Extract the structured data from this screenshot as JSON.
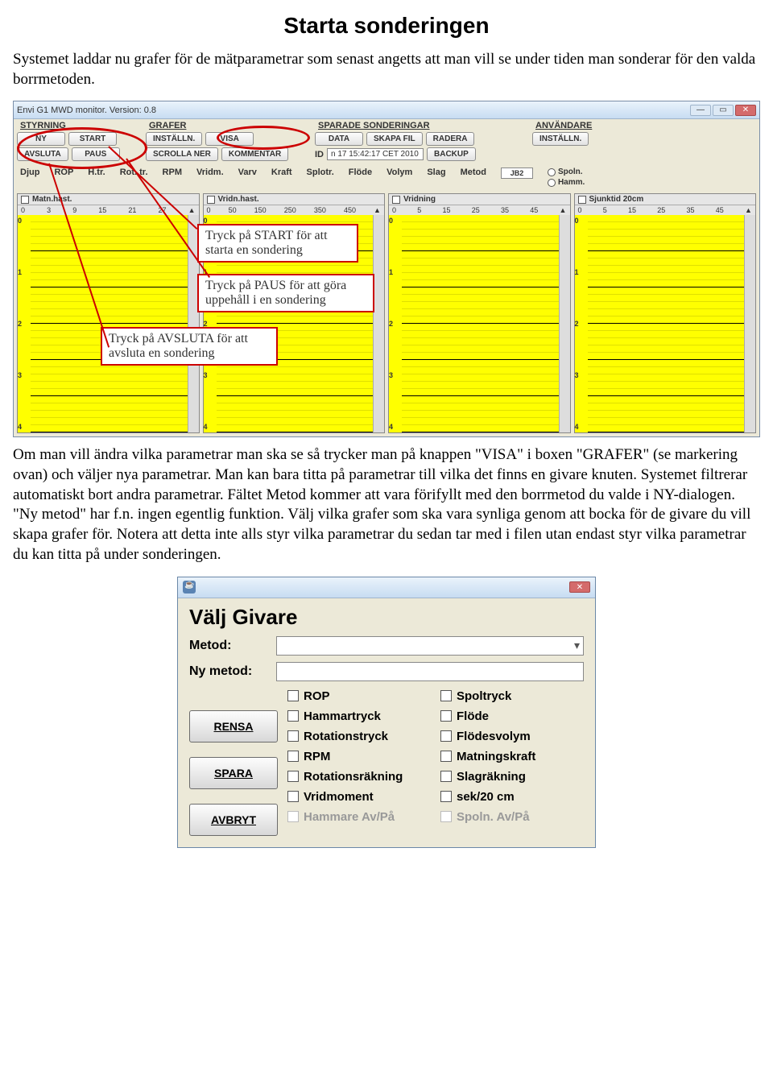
{
  "doc": {
    "title": "Starta sonderingen",
    "intro": "Systemet laddar nu grafer för de mätparametrar som senast angetts att man vill se under tiden man sonderar för den valda borrmetoden.",
    "para2": "Om man vill ändra vilka parametrar man ska se så trycker man på knappen \"VISA\" i boxen \"GRAFER\" (se markering ovan) och väljer nya parametrar. Man kan bara titta på parametrar till vilka det finns en givare knuten. Systemet filtrerar automatiskt bort andra parametrar. Fältet Metod kommer att vara förifyllt med den borrmetod du valde i NY-dialogen. \"Ny metod\" har f.n. ingen egentlig funktion. Välj vilka grafer som ska vara synliga genom att bocka för de givare du vill skapa grafer för. Notera att detta inte alls styr vilka parametrar du sedan tar med i filen utan endast styr vilka parametrar du kan titta på under sonderingen."
  },
  "callouts": {
    "start": "Tryck på START för att starta en sondering",
    "paus": "Tryck på PAUS för att göra uppehåll i en sondering",
    "avsluta": "Tryck på AVSLUTA för att avsluta en sondering"
  },
  "app": {
    "title": "Envi G1 MWD monitor. Version: 0.8",
    "groups": {
      "styrning": {
        "label": "STYRNING",
        "ny": "NY",
        "start": "START",
        "avsluta": "AVSLUTA",
        "paus": "PAUS"
      },
      "grafer": {
        "label": "GRAFER",
        "installn": "INSTÄLLN.",
        "visa": "VISA",
        "scrolla": "SCROLLA NER",
        "kommentar": "KOMMENTAR"
      },
      "sparade": {
        "label": "SPARADE SONDERINGAR",
        "data": "DATA",
        "skapa": "SKAPA FIL",
        "radera": "RADERA",
        "id_label": "ID",
        "id_value": "n 17 15:42:17 CET 2010",
        "backup": "BACKUP"
      },
      "anvandare": {
        "label": "ANVÄNDARE",
        "installn": "INSTÄLLN."
      }
    },
    "params": {
      "djup": "Djup",
      "rop": "ROP",
      "htr": "H.tr.",
      "rottr": "Rot. tr.",
      "rpm": "RPM",
      "vridm": "Vridm.",
      "varv": "Varv",
      "kraft": "Kraft",
      "splotr": "Splotr.",
      "flode": "Flöde",
      "volym": "Volym",
      "slag": "Slag",
      "metod": "Metod",
      "metod_value": "JB2",
      "spoln": "Spoln.",
      "hamm": "Hamm."
    },
    "graphs": [
      {
        "name": "Matn.hast.",
        "scale": [
          "0",
          "3",
          "9",
          "15",
          "21",
          "27"
        ],
        "y": [
          "0",
          "1",
          "2",
          "3",
          "4"
        ]
      },
      {
        "name": "Vridn.hast.",
        "scale": [
          "0",
          "50",
          "150",
          "250",
          "350",
          "450"
        ],
        "y": [
          "0",
          "1",
          "2",
          "3",
          "4"
        ]
      },
      {
        "name": "Vridning",
        "scale": [
          "0",
          "5",
          "15",
          "25",
          "35",
          "45"
        ],
        "y": [
          "0",
          "1",
          "2",
          "3",
          "4"
        ]
      },
      {
        "name": "Sjunktid 20cm",
        "scale": [
          "0",
          "5",
          "15",
          "25",
          "35",
          "45"
        ],
        "y": [
          "0",
          "1",
          "2",
          "3",
          "4"
        ]
      }
    ]
  },
  "dialog": {
    "heading": "Välj Givare",
    "metod_label": "Metod:",
    "nymetod_label": "Ny metod:",
    "buttons": {
      "rensa": "RENSA",
      "spara": "SPARA",
      "avbryt": "AVBRYT"
    },
    "col1": [
      {
        "label": "ROP",
        "disabled": false
      },
      {
        "label": "Hammartryck",
        "disabled": false
      },
      {
        "label": "Rotationstryck",
        "disabled": false
      },
      {
        "label": "RPM",
        "disabled": false
      },
      {
        "label": "Rotationsräkning",
        "disabled": false
      },
      {
        "label": "Vridmoment",
        "disabled": false
      },
      {
        "label": "Hammare Av/På",
        "disabled": true
      }
    ],
    "col2": [
      {
        "label": "Spoltryck",
        "disabled": false
      },
      {
        "label": "Flöde",
        "disabled": false
      },
      {
        "label": "Flödesvolym",
        "disabled": false
      },
      {
        "label": "Matningskraft",
        "disabled": false
      },
      {
        "label": "Slagräkning",
        "disabled": false
      },
      {
        "label": "sek/20 cm",
        "disabled": false
      },
      {
        "label": "Spoln. Av/På",
        "disabled": true
      }
    ]
  }
}
